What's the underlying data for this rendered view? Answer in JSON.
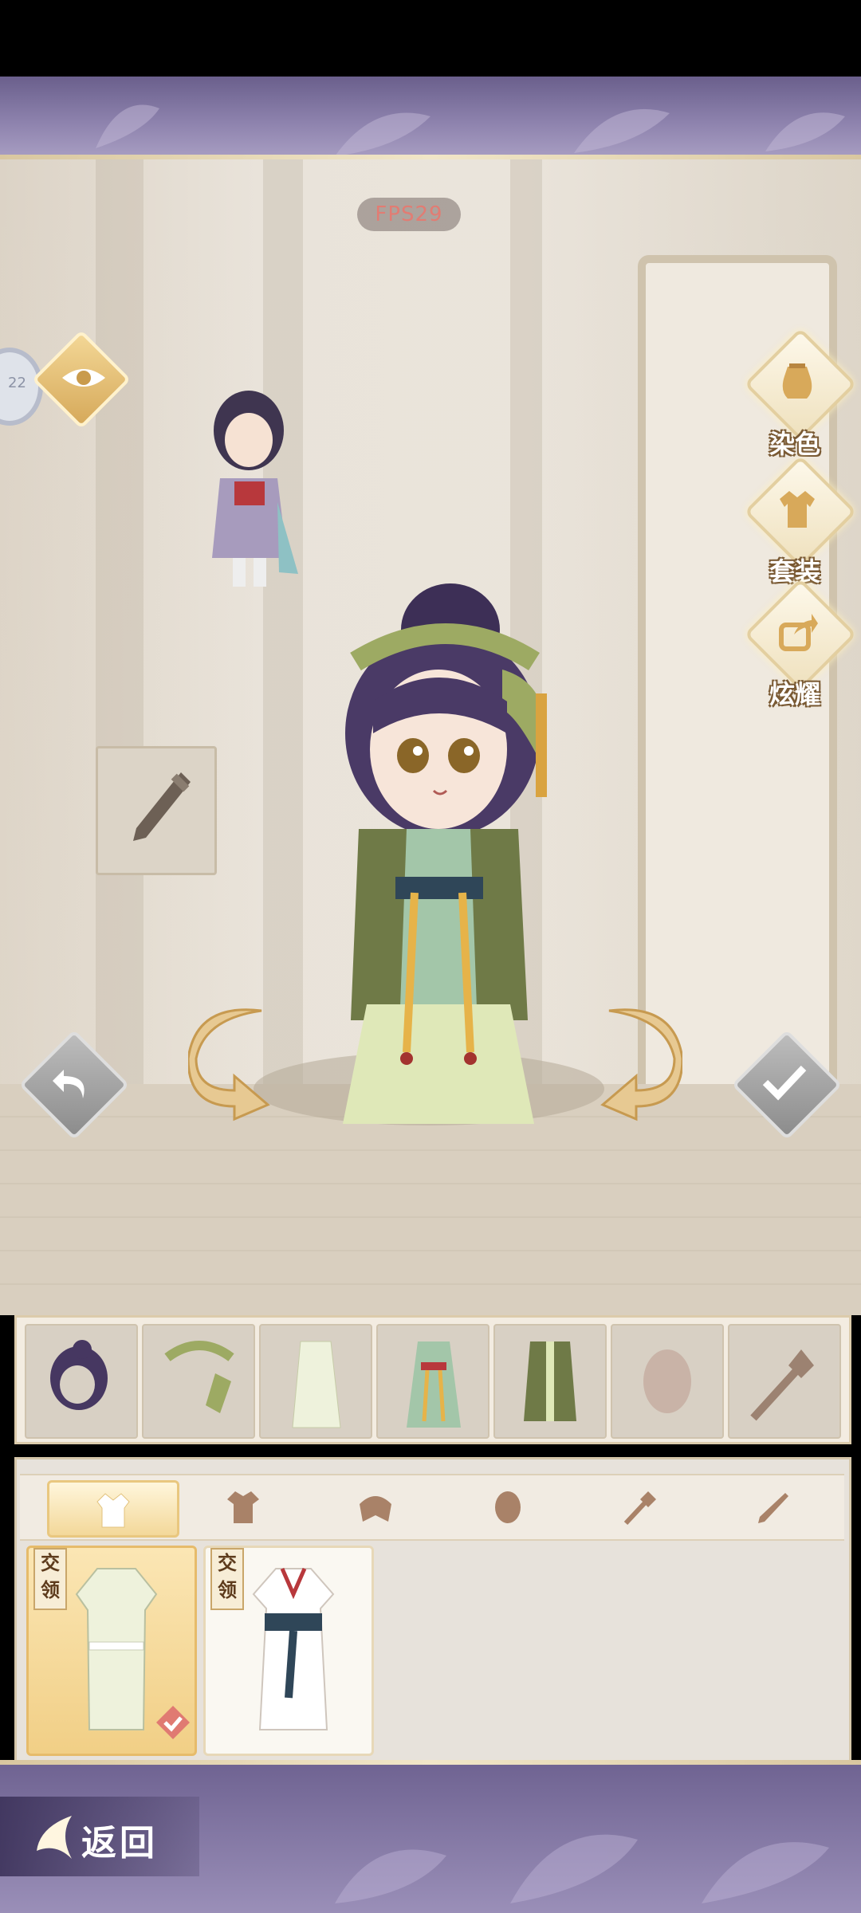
{
  "hud": {
    "fps_label": "FPS29"
  },
  "toggle_left": {
    "text": "22"
  },
  "side_menu": [
    {
      "label": "染色",
      "icon": "dye-jar-icon"
    },
    {
      "label": "套装",
      "icon": "outfit-set-icon"
    },
    {
      "label": "炫耀",
      "icon": "share-icon"
    }
  ],
  "equipped_slots": [
    {
      "icon": "hairstyle-icon"
    },
    {
      "icon": "hair-ribbon-icon"
    },
    {
      "icon": "inner-robe-icon"
    },
    {
      "icon": "dress-icon"
    },
    {
      "icon": "outer-vest-icon"
    },
    {
      "icon": "face-mask-icon"
    },
    {
      "icon": "hairpin-icon"
    }
  ],
  "categories": [
    {
      "icon": "robe-icon",
      "selected": true
    },
    {
      "icon": "jacket-icon",
      "selected": false
    },
    {
      "icon": "cape-icon",
      "selected": false
    },
    {
      "icon": "mask-icon",
      "selected": false
    },
    {
      "icon": "hairpin-icon",
      "selected": false
    },
    {
      "icon": "dagger-icon",
      "selected": false
    }
  ],
  "items": [
    {
      "tag": "交领",
      "selected": true,
      "equipped": true
    },
    {
      "tag": "交领",
      "selected": false,
      "equipped": false
    }
  ],
  "footer": {
    "back_label": "返回"
  },
  "colors": {
    "banner": "#7a6f9c",
    "gold": "#e6cd96",
    "accent_red": "#e07a72"
  }
}
